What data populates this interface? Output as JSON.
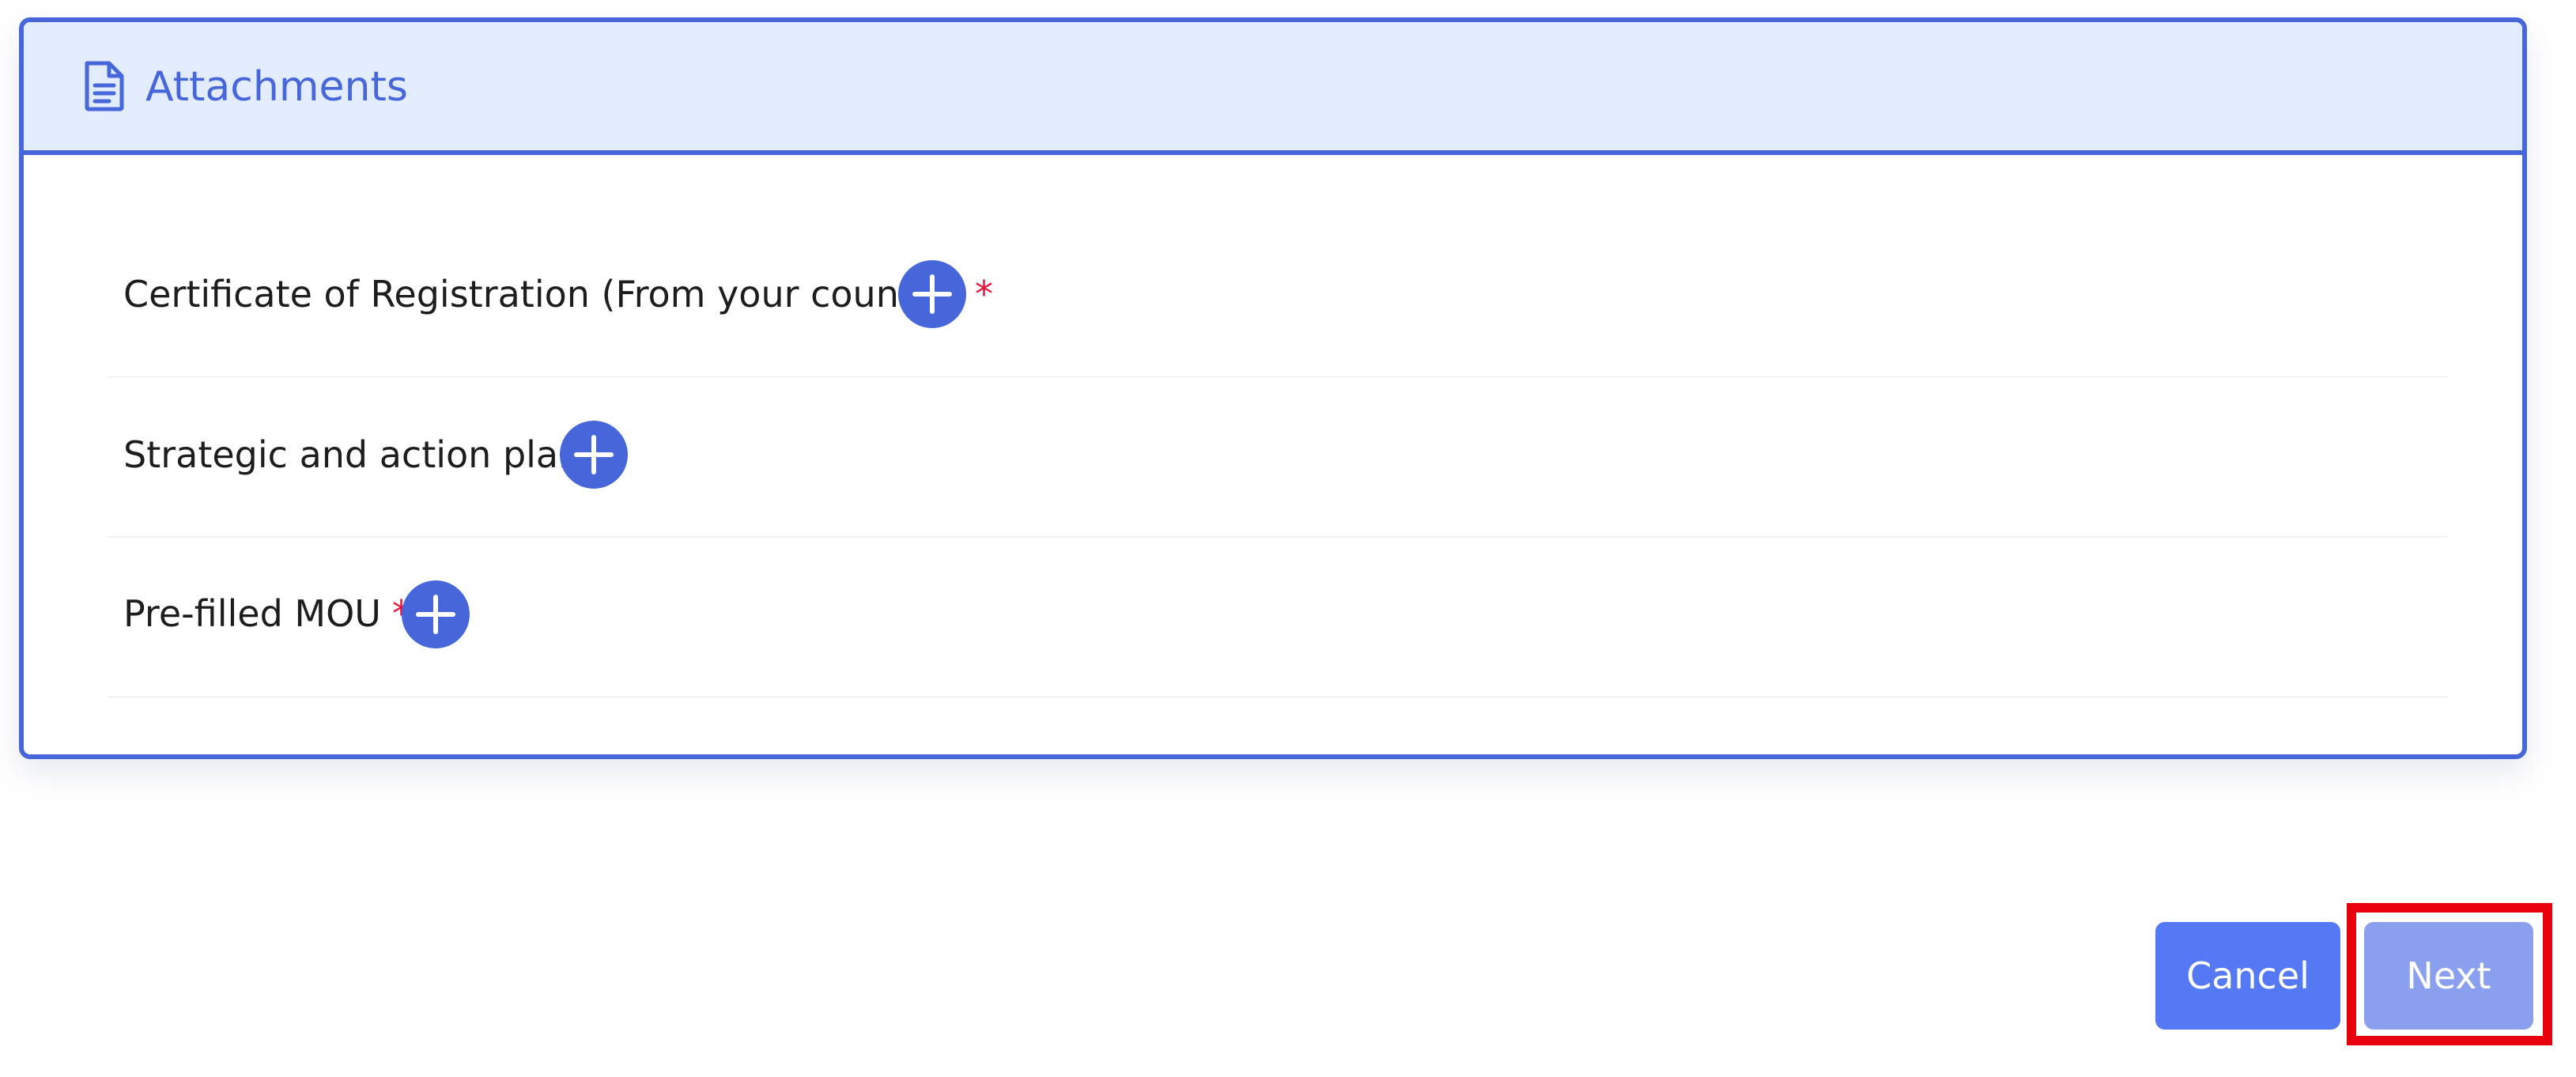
{
  "attachments_card": {
    "title": "Attachments",
    "header_icon": "document-icon",
    "accent_color": "#4666da",
    "header_bg": "#e2ecfc",
    "items": [
      {
        "label": "Certificate of Registration (From your country)",
        "required_mark": "*",
        "add_icon": "plus-icon"
      },
      {
        "label": "Strategic and action plan",
        "required_mark": "*",
        "add_icon": "plus-icon"
      },
      {
        "label": "Pre-filled MOU",
        "required_mark": "*",
        "add_icon": "plus-icon"
      }
    ]
  },
  "footer": {
    "cancel_label": "Cancel",
    "next_label": "Next",
    "cancel_color": "#5578f5",
    "next_color": "#8aa0ee",
    "highlight_color": "#e8000d"
  }
}
